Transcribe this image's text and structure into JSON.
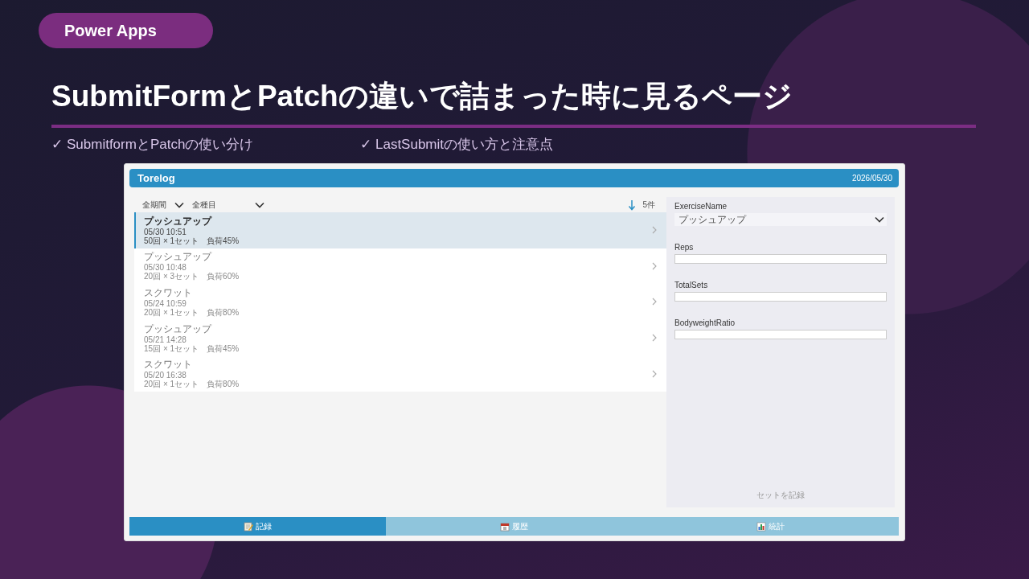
{
  "slide": {
    "badge": "Power Apps",
    "title": "SubmitFormとPatchの違いで詰まった時に見るページ",
    "points": [
      "✓ SubmitformとPatchの使い分け",
      "✓ LastSubmitの使い方と注意点"
    ]
  },
  "app": {
    "title": "Torelog",
    "date": "2026/05/30",
    "filters": [
      {
        "value": "全期間"
      },
      {
        "value": "全種目"
      }
    ],
    "count": "5件",
    "records": [
      {
        "name": "プッシュアップ",
        "time": "05/30 10:51",
        "detail": "50回 × 1セット　負荷45%",
        "selected": true
      },
      {
        "name": "プッシュアップ",
        "time": "05/30 10:48",
        "detail": "20回 × 3セット　負荷60%",
        "selected": false
      },
      {
        "name": "スクワット",
        "time": "05/24 10:59",
        "detail": "20回 × 1セット　負荷80%",
        "selected": false
      },
      {
        "name": "プッシュアップ",
        "time": "05/21 14:28",
        "detail": "15回 × 1セット　負荷45%",
        "selected": false
      },
      {
        "name": "スクワット",
        "time": "05/20 16:38",
        "detail": "20回 × 1セット　負荷80%",
        "selected": false
      }
    ],
    "form": {
      "fields": [
        {
          "kind": "dropdown",
          "label": "ExerciseName",
          "value": "プッシュアップ"
        },
        {
          "kind": "text",
          "label": "Reps"
        },
        {
          "kind": "text",
          "label": "TotalSets"
        },
        {
          "kind": "text",
          "label": "BodyweightRatio"
        }
      ],
      "submit": {
        "label": "セットを記録",
        "disabled": true
      }
    },
    "tabs": [
      {
        "kind": "memo",
        "label": "記録",
        "selected": true
      },
      {
        "kind": "calendar",
        "label": "履歴",
        "selected": false
      },
      {
        "kind": "chart",
        "label": "統計",
        "selected": false
      }
    ]
  }
}
